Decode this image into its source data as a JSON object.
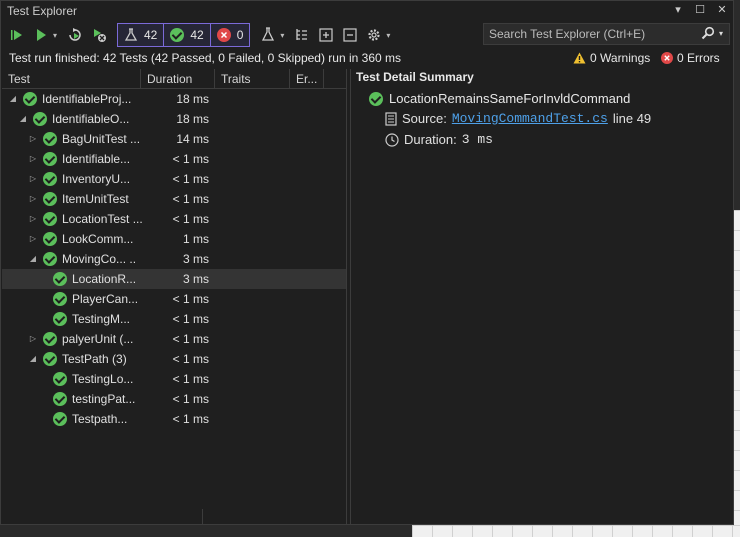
{
  "window": {
    "title": "Test Explorer"
  },
  "toolbar": {
    "counters": {
      "total": "42",
      "passed": "42",
      "failed": "0"
    }
  },
  "search": {
    "placeholder": "Search Test Explorer (Ctrl+E)"
  },
  "status": {
    "summary": "Test run finished: 42 Tests (42 Passed, 0 Failed, 0 Skipped) run in 360 ms",
    "warnings": "0 Warnings",
    "errors": "0 Errors"
  },
  "grid": {
    "columns": [
      "Test",
      "Duration",
      "Traits",
      "Er..."
    ],
    "rows": [
      {
        "name": "IdentifiableProj...",
        "duration": "18 ms",
        "indent": 0,
        "expander": "open"
      },
      {
        "name": "IdentifiableO...",
        "duration": "18 ms",
        "indent": 1,
        "expander": "open"
      },
      {
        "name": "BagUnitTest ...",
        "duration": "14 ms",
        "indent": 2,
        "expander": "closed"
      },
      {
        "name": "Identifiable...",
        "duration": "< 1 ms",
        "indent": 2,
        "expander": "closed"
      },
      {
        "name": "InventoryU...",
        "duration": "< 1 ms",
        "indent": 2,
        "expander": "closed"
      },
      {
        "name": "ItemUnitTest",
        "duration": "< 1 ms",
        "indent": 2,
        "expander": "closed"
      },
      {
        "name": "LocationTest ...",
        "duration": "< 1 ms",
        "indent": 2,
        "expander": "closed"
      },
      {
        "name": "LookComm...",
        "duration": "1 ms",
        "indent": 2,
        "expander": "closed"
      },
      {
        "name": "MovingCo... ..",
        "duration": "3 ms",
        "indent": 2,
        "expander": "open"
      },
      {
        "name": "LocationR...",
        "duration": "3 ms",
        "indent": 3,
        "expander": "none",
        "selected": true
      },
      {
        "name": "PlayerCan...",
        "duration": "< 1 ms",
        "indent": 3,
        "expander": "none"
      },
      {
        "name": "TestingM...",
        "duration": "< 1 ms",
        "indent": 3,
        "expander": "none"
      },
      {
        "name": "palyerUnit (...",
        "duration": "< 1 ms",
        "indent": 2,
        "expander": "closed"
      },
      {
        "name": "TestPath  (3)",
        "duration": "< 1 ms",
        "indent": 2,
        "expander": "open"
      },
      {
        "name": "TestingLo...",
        "duration": "< 1 ms",
        "indent": 3,
        "expander": "none"
      },
      {
        "name": "testingPat...",
        "duration": "< 1 ms",
        "indent": 3,
        "expander": "none"
      },
      {
        "name": "Testpath...",
        "duration": "< 1 ms",
        "indent": 3,
        "expander": "none"
      }
    ]
  },
  "detail": {
    "title": "Test Detail Summary",
    "test_name": "LocationRemainsSameForInvldCommand",
    "source_label": "Source:",
    "source_file": "MovingCommandTest.cs",
    "source_line": "line 49",
    "duration_label": "Duration:",
    "duration_value": "3 ms"
  },
  "colors": {
    "pass": "#5bbf5b",
    "fail": "#e04848",
    "accent": "#7b6ad8",
    "link": "#4ea0e8"
  }
}
